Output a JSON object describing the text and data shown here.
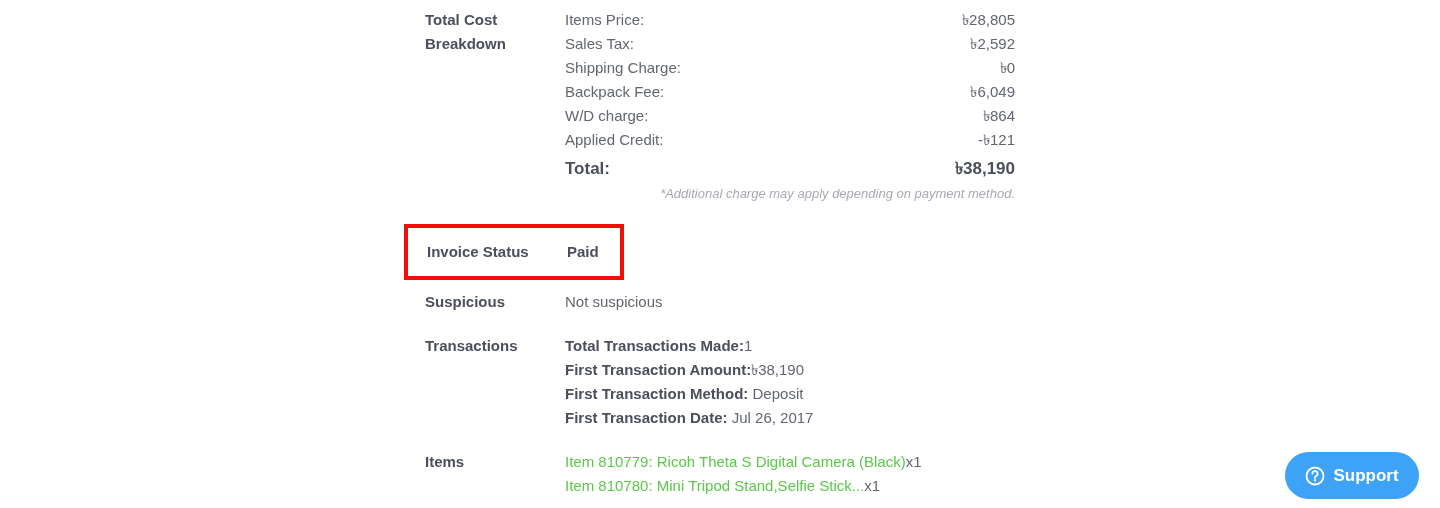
{
  "cost_breakdown": {
    "label": "Total Cost Breakdown",
    "lines": [
      {
        "name": "Items Price:",
        "amount": "৳28,805"
      },
      {
        "name": "Sales Tax:",
        "amount": "৳2,592"
      },
      {
        "name": "Shipping Charge:",
        "amount": "৳0"
      },
      {
        "name": "Backpack Fee:",
        "amount": "৳6,049"
      },
      {
        "name": "W/D charge:",
        "amount": "৳864"
      },
      {
        "name": "Applied Credit:",
        "amount": "-৳121"
      }
    ],
    "total": {
      "name": "Total:",
      "amount": "৳38,190"
    },
    "note": "*Additional charge may apply depending on payment method."
  },
  "invoice_status": {
    "label": "Invoice Status",
    "value": "Paid",
    "highlighted": true
  },
  "suspicious": {
    "label": "Suspicious",
    "value": "Not suspicious"
  },
  "transactions": {
    "label": "Transactions",
    "lines": [
      "**Total Transactions Made:**1",
      "**First Transaction Amount:**৳38,190",
      "**First Transaction Method:** Deposit",
      "**First Transaction Date:** Jul 26, 2017"
    ]
  },
  "items": {
    "label": "Items",
    "list": [
      {
        "name": "Item 810779: Ricoh Theta S Digital Camera (Black)",
        "quantity": "x1"
      },
      {
        "name": "Item 810780: Mini Tripod Stand,Selfie Stick...",
        "quantity": "x1"
      }
    ]
  },
  "support_button": {
    "label": "Support"
  }
}
